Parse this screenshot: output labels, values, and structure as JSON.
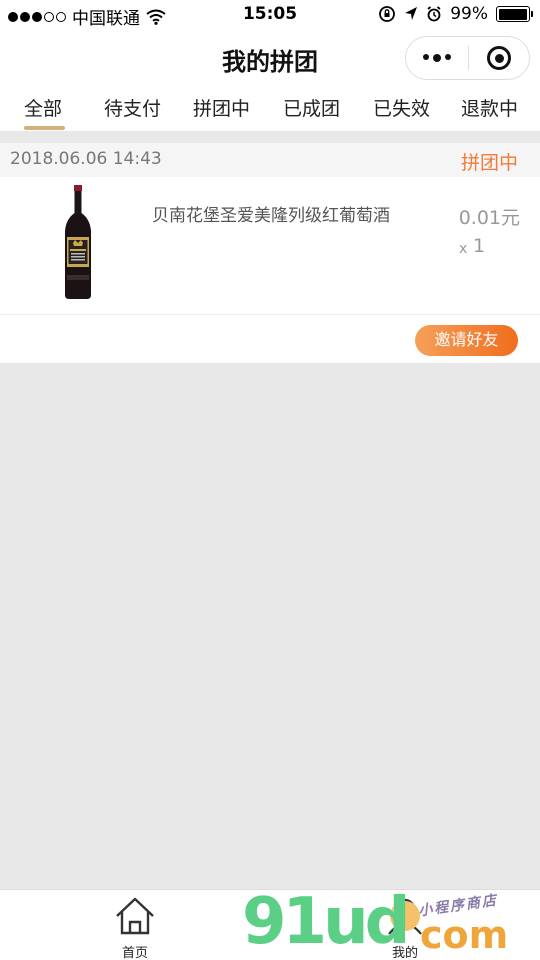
{
  "status_bar": {
    "carrier": "中国联通",
    "time": "15:05",
    "battery": "99%",
    "battery_level": 0.99,
    "signal_bars": 3,
    "signal_total": 5,
    "icons": [
      "wifi-icon",
      "rotation-lock-icon",
      "location-arrow-icon",
      "alarm-icon",
      "battery-icon"
    ]
  },
  "nav": {
    "title": "我的拼团",
    "capsule_icons": [
      "more-dots-icon",
      "close-target-icon"
    ]
  },
  "tabs": [
    {
      "label": "全部",
      "active": true
    },
    {
      "label": "待支付",
      "active": false
    },
    {
      "label": "拼团中",
      "active": false
    },
    {
      "label": "已成团",
      "active": false
    },
    {
      "label": "已失效",
      "active": false
    },
    {
      "label": "退款中",
      "active": false
    }
  ],
  "order": {
    "time": "2018.06.06 14:43",
    "status": "拼团中",
    "product_name": "贝南花堡圣爱美隆列级红葡萄酒",
    "price": "0.01元",
    "qty_prefix": "x",
    "qty": "1",
    "invite_label": "邀请好友",
    "image": "wine-bottle"
  },
  "tab_bar": {
    "items": [
      {
        "label": "首页",
        "icon": "home-icon"
      },
      {
        "label": "我的",
        "icon": "user-icon"
      }
    ]
  },
  "watermark": {
    "brand": "91ud",
    "suffix": "com",
    "subtitle": "小程序商店"
  },
  "colors": {
    "accent": "#f27a3b",
    "tab_underline": "#d4b07a",
    "button_start": "#f5a05a",
    "button_end": "#f06d1e"
  }
}
